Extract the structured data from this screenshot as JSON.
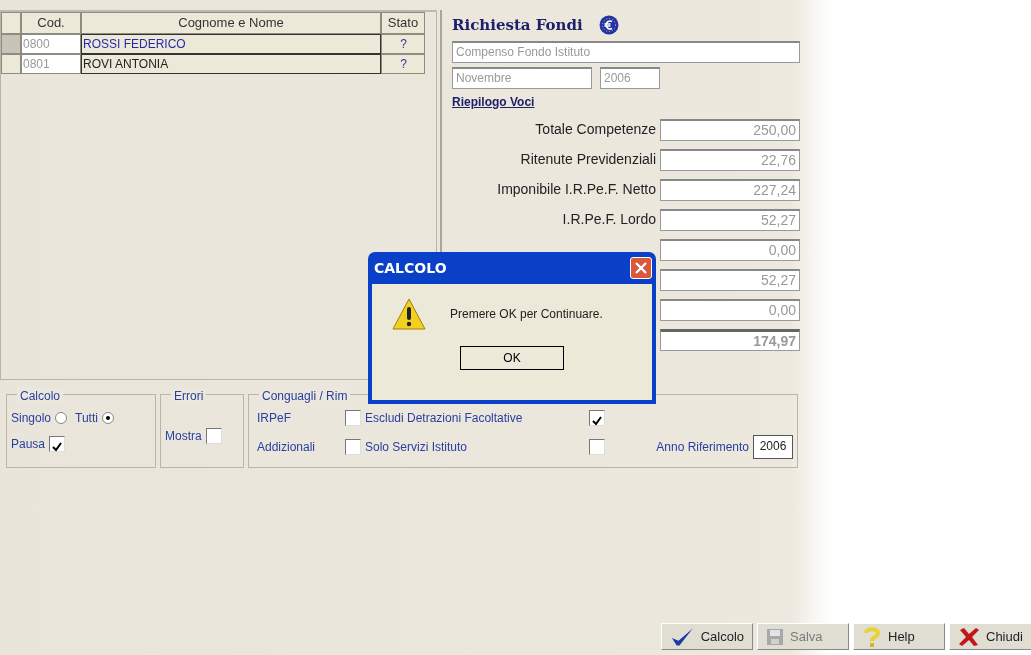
{
  "grid": {
    "columns": [
      "Cod.",
      "Cognome e Nome",
      "Stato"
    ],
    "rows": [
      {
        "code": "0800",
        "name": "ROSSI FEDERICO",
        "status": "?",
        "selected": true
      },
      {
        "code": "0801",
        "name": "ROVI  ANTONIA",
        "status": "?",
        "selected": false
      }
    ]
  },
  "fund_request": {
    "title": "Richiesta Fondi",
    "description": "Compenso Fondo Istituto",
    "month": "Novembre",
    "year": "2006",
    "summary_title": "Riepilogo Voci",
    "rows": [
      {
        "kind": "item",
        "label": "Totale Competenze",
        "value": "250,00"
      },
      {
        "kind": "item",
        "label": "Ritenute Previdenziali",
        "value": "22,76"
      },
      {
        "kind": "item",
        "label": "Imponibile I.R.Pe.F. Netto",
        "value": "227,24"
      },
      {
        "kind": "item",
        "label": "I.R.Pe.F. Lordo",
        "value": "52,27"
      },
      {
        "kind": "item",
        "value": "0,00"
      },
      {
        "kind": "item",
        "value": "52,27"
      },
      {
        "kind": "item",
        "value": "0,00"
      },
      {
        "kind": "total",
        "value": "174,97"
      }
    ]
  },
  "calcolo": {
    "title": "Calcolo",
    "options": [
      {
        "label": "Singolo",
        "selected": false
      },
      {
        "label": "Tutti",
        "selected": true
      }
    ],
    "pause": {
      "label": "Pausa",
      "checked": true
    }
  },
  "errori": {
    "title": "Errori",
    "show": {
      "label": "Mostra",
      "checked": false
    }
  },
  "conguagli": {
    "title": "Conguagli / Rim",
    "options": [
      {
        "label": "IRPeF",
        "checked": false
      },
      {
        "label": "Escludi Detrazioni Facoltative",
        "checked": true
      },
      {
        "label": "Addizionali",
        "checked": false
      },
      {
        "label": "Solo Servizi Istituto",
        "checked": false
      }
    ],
    "year_label": "Anno Riferimento",
    "year": "2006"
  },
  "dialog": {
    "title": "CALCOLO",
    "message": "Premere OK per Continuare.",
    "button": "OK"
  },
  "toolbar": [
    {
      "kind": "check",
      "label": "Calcolo",
      "disabled": false
    },
    {
      "kind": "save",
      "label": "Salva",
      "disabled": true
    },
    {
      "kind": "help",
      "label": "Help",
      "disabled": false
    },
    {
      "kind": "close",
      "label": "Chiudi",
      "disabled": false
    }
  ]
}
